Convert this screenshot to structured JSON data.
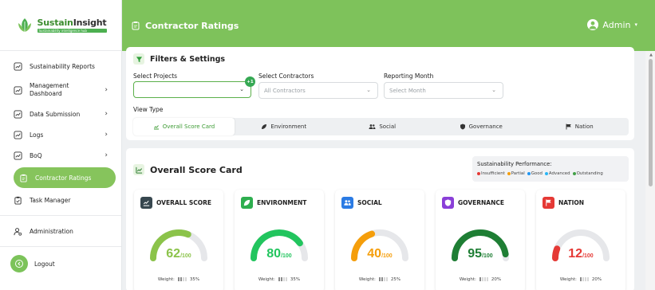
{
  "brand": {
    "name_a": "Sustain",
    "name_b": "Insight",
    "tagline": "Sustainability intelligence hub"
  },
  "sidebar": {
    "items": [
      {
        "label": "Sustainability Reports",
        "chevron": false
      },
      {
        "label": "Management Dashboard",
        "chevron": true
      },
      {
        "label": "Data Submission",
        "chevron": true
      },
      {
        "label": "Logs",
        "chevron": true
      },
      {
        "label": "BoQ",
        "chevron": true
      },
      {
        "label": "Contractor Ratings",
        "chevron": false,
        "active": true
      },
      {
        "label": "Task Manager",
        "chevron": false
      }
    ],
    "admin": "Administration",
    "logout": "Logout"
  },
  "header": {
    "title": "Contractor Ratings",
    "user": "Admin"
  },
  "filters": {
    "title": "Filters & Settings",
    "projects_label": "Select Projects",
    "projects_badge": "+1",
    "contractors_label": "Select Contractors",
    "contractors_placeholder": "All Contractors",
    "month_label": "Reporting Month",
    "month_placeholder": "Select Month",
    "view_type_label": "View Type",
    "tabs": [
      "Overall Score Card",
      "Environment",
      "Social",
      "Governance",
      "Nation"
    ]
  },
  "scorecard": {
    "title": "Overall Score Card",
    "perf_title": "Sustainability Performance:",
    "legend": [
      {
        "label": "Insufficient",
        "color": "#e53935"
      },
      {
        "label": "Partial",
        "color": "#f59e0b"
      },
      {
        "label": "Good",
        "color": "#2196f3"
      },
      {
        "label": "Advanced",
        "color": "#29b6f6"
      },
      {
        "label": "Outstanding",
        "color": "#43a047"
      }
    ],
    "weight_label": "Weight:",
    "cards": [
      {
        "title": "OVERALL SCORE",
        "score": "62",
        "max": "/100",
        "fraction": 0.62,
        "color": "#8bc34a",
        "icon_bg": "#37474f",
        "weight": "35%",
        "weight_bars": 2
      },
      {
        "title": "ENVIRONMENT",
        "score": "80",
        "max": "/100",
        "fraction": 0.8,
        "color": "#22c55e",
        "icon_bg": "#2eae4f",
        "weight": "35%",
        "weight_bars": 2
      },
      {
        "title": "SOCIAL",
        "score": "40",
        "max": "/100",
        "fraction": 0.4,
        "color": "#f59e0b",
        "icon_bg": "#2b7be4",
        "weight": "25%",
        "weight_bars": 2
      },
      {
        "title": "GOVERNANCE",
        "score": "95",
        "max": "/100",
        "fraction": 0.95,
        "color": "#1e7e34",
        "icon_bg": "#8a3fd8",
        "weight": "20%",
        "weight_bars": 1
      },
      {
        "title": "NATION",
        "score": "12",
        "max": "/100",
        "fraction": 0.12,
        "color": "#e53935",
        "icon_bg": "#e53935",
        "weight": "20%",
        "weight_bars": 1
      }
    ]
  }
}
